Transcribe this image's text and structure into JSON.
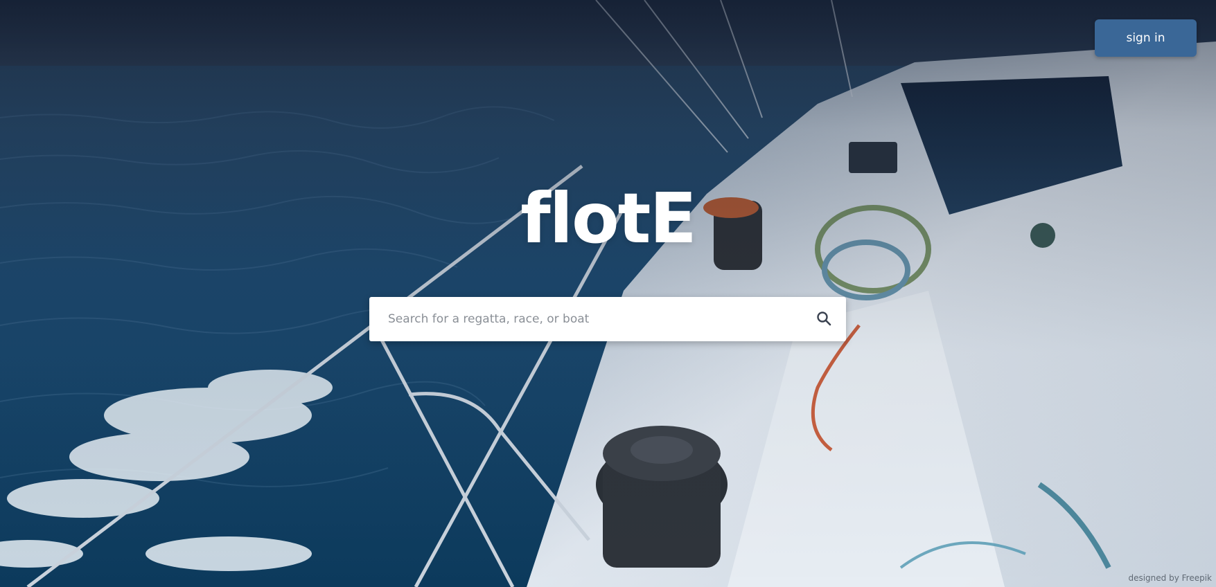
{
  "header": {
    "signin_label": "sign in"
  },
  "hero": {
    "logo_text": "flotE"
  },
  "search": {
    "placeholder": "Search for a regatta, race, or boat",
    "value": "",
    "icon": "search-icon"
  },
  "footer": {
    "credit_text": "designed by Freepik"
  },
  "colors": {
    "button_bg": "#3a6797",
    "sea_dark": "#0e3a5a",
    "deck": "#dde4ec"
  }
}
